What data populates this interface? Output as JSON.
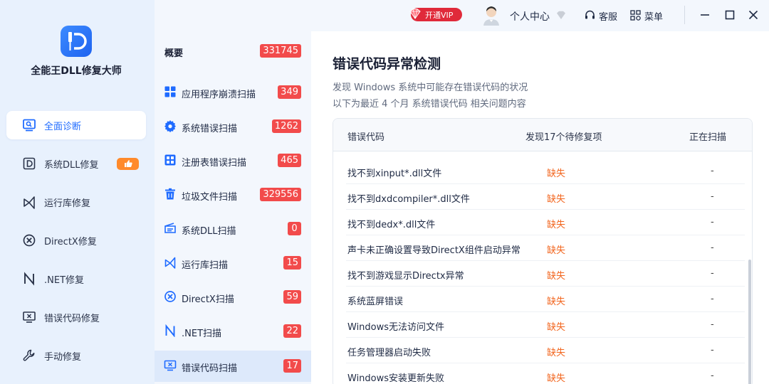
{
  "app": {
    "name": "全能王DLL修复大师"
  },
  "sidebar": {
    "items": [
      {
        "label": "全面诊断",
        "icon": "monitor-search-icon",
        "active": true
      },
      {
        "label": "系统DLL修复",
        "icon": "dll-d-icon",
        "badge": "thumbs-up-icon"
      },
      {
        "label": "运行库修复",
        "icon": "runtime-icon"
      },
      {
        "label": "DirectX修复",
        "icon": "directx-icon"
      },
      {
        "label": ".NET修复",
        "icon": "dotnet-n-icon"
      },
      {
        "label": "错误代码修复",
        "icon": "error-screen-icon"
      },
      {
        "label": "手动修复",
        "icon": "wrench-icon"
      }
    ]
  },
  "scanlist": {
    "overview": {
      "label": "概要",
      "count": "331745"
    },
    "items": [
      {
        "label": "应用程序崩溃扫描",
        "count": "349",
        "icon": "grid-icon"
      },
      {
        "label": "系统错误扫描",
        "count": "1262",
        "icon": "gear-icon"
      },
      {
        "label": "注册表错误扫描",
        "count": "465",
        "icon": "registry-icon"
      },
      {
        "label": "垃圾文件扫描",
        "count": "329556",
        "icon": "trash-icon"
      },
      {
        "label": "系统DLL扫描",
        "count": "0",
        "icon": "dll-scan-icon"
      },
      {
        "label": "运行库扫描",
        "count": "15",
        "icon": "runtime-icon"
      },
      {
        "label": "DirectX扫描",
        "count": "59",
        "icon": "directx-icon"
      },
      {
        "label": ".NET扫描",
        "count": "22",
        "icon": "dotnet-n-icon"
      },
      {
        "label": "错误代码扫描",
        "count": "17",
        "icon": "error-screen-icon",
        "active": true
      }
    ]
  },
  "titlebar": {
    "vip_label": "开通VIP",
    "user_center": "个人中心",
    "service": "客服",
    "menu": "菜单"
  },
  "main": {
    "title": "错误代码异常检测",
    "desc1": "发现 Windows 系统中可能存在错误代码的状况",
    "desc2": "以下为最近 4 个月 系统错误代码 相关问题内容",
    "table": {
      "headers": [
        "错误代码",
        "发现17个待修复项",
        "正在扫描"
      ],
      "rows": [
        {
          "name": "找不到xinput*.dll文件",
          "status": "缺失",
          "scan": "-"
        },
        {
          "name": "找不到dxdcompiler*.dll文件",
          "status": "缺失",
          "scan": "-"
        },
        {
          "name": "找不到dedx*.dll文件",
          "status": "缺失",
          "scan": "-"
        },
        {
          "name": "声卡未正确设置导致DirectX组件启动异常",
          "status": "缺失",
          "scan": "-"
        },
        {
          "name": "找不到游戏显示Directx异常",
          "status": "缺失",
          "scan": "-"
        },
        {
          "name": "系统蓝屏错误",
          "status": "缺失",
          "scan": "-"
        },
        {
          "name": "Windows无法访问文件",
          "status": "缺失",
          "scan": "-"
        },
        {
          "name": "任务管理器启动失败",
          "status": "缺失",
          "scan": "-"
        },
        {
          "name": "Windows安装更新失败",
          "status": "缺失",
          "scan": "-"
        }
      ]
    }
  },
  "colors": {
    "accent": "#1f6bff",
    "badge_red": "#f24b4b",
    "missing_orange": "#f2661f",
    "sidebar_bg": "#e8f1fd"
  }
}
